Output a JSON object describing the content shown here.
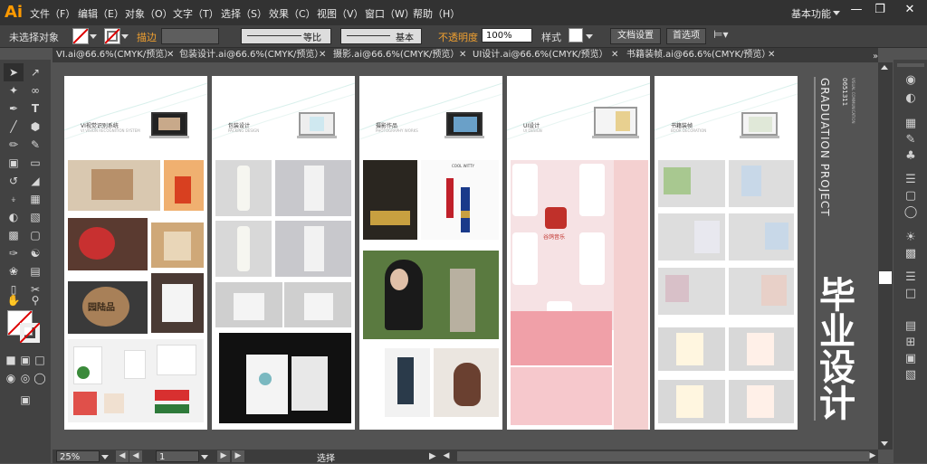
{
  "app": {
    "logo": "Ai"
  },
  "menu": [
    "文件（F）",
    "编辑（E）",
    "对象（O）",
    "文字（T）",
    "选择（S）",
    "效果（C）",
    "视图（V）",
    "窗口（W）",
    "帮助（H）"
  ],
  "workspace": "基本功能",
  "control": {
    "selection_status": "未选择对象",
    "stroke_label": "描边",
    "stroke_profile": "等比",
    "brush": "基本",
    "opacity_label": "不透明度",
    "opacity_value": "100%",
    "style_label": "样式",
    "doc_settings": "文档设置",
    "preferences": "首选项"
  },
  "tabs": [
    "VI.ai@66.6%(CMYK/预览）",
    "包装设计.ai@66.6%(CMYK/预览）",
    "摄影.ai@66.6%(CMYK/预览）",
    "UI设计.ai@66.6%(CMYK/预览）",
    "书籍装帧.ai@66.6%(CMYK/预览）"
  ],
  "boards": [
    {
      "title": "VI视觉识别系统",
      "subtitle": "VI VISION RECOGNITION SYSTEM",
      "brand": "园陆品"
    },
    {
      "title": "包装设计",
      "subtitle": "PACKING DESIGN"
    },
    {
      "title": "摄影作品",
      "subtitle": "PHOTOGRAPHY WORKS",
      "product": "COOL WITTY"
    },
    {
      "title": "UI设计",
      "subtitle": "UI DESIGN",
      "app_name": "谷鸽音乐"
    },
    {
      "title": "书籍装帧",
      "subtitle": "BOOK DECORATION"
    }
  ],
  "side_text": {
    "main": "GRADUATION PROJECT",
    "small1": "0651311",
    "small2": "VISUAL COMMUNICATION",
    "big": "毕业设计"
  },
  "status": {
    "zoom": "25%",
    "page": "1",
    "tool": "选择"
  },
  "colors": {
    "accent": "#ff9a00",
    "bg": "#535353"
  }
}
